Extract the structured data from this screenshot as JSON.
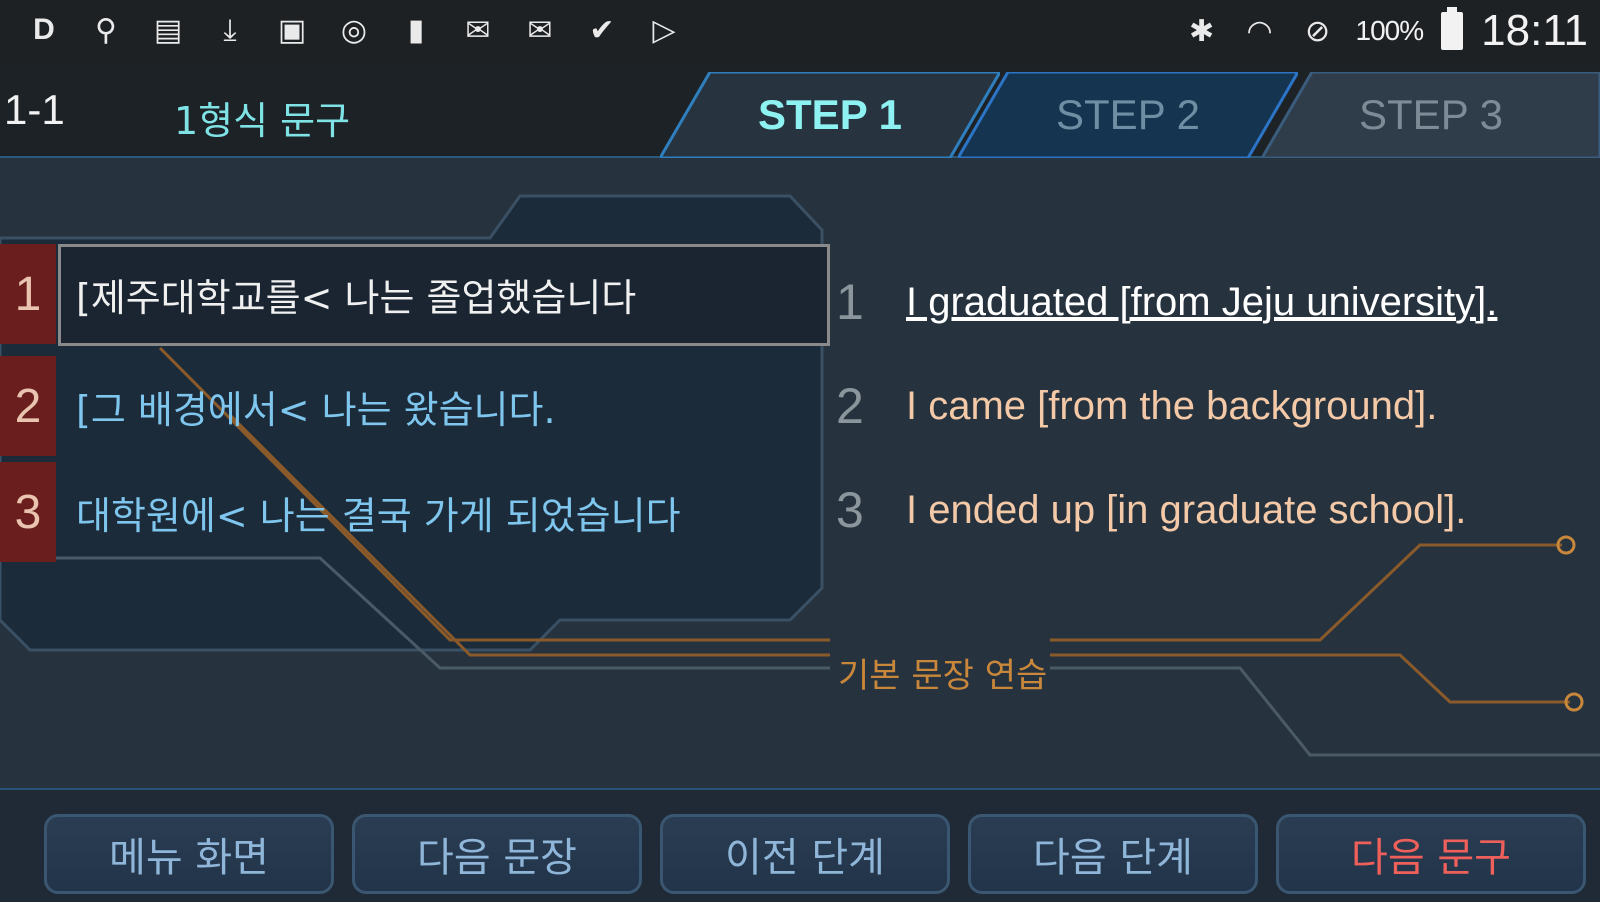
{
  "statusbar": {
    "left_icons": [
      "d-app-icon",
      "usb-icon",
      "sim-icon",
      "download-icon",
      "image-icon",
      "sync-icon",
      "battery-saver-icon",
      "mail-icon",
      "mail-icon",
      "check-icon",
      "play-icon"
    ],
    "battery_pct": "100%",
    "clock": "18:11"
  },
  "header": {
    "lesson_number": "1-1",
    "lesson_title": "1형식 문구",
    "tabs": [
      {
        "label": "STEP 1",
        "active": true
      },
      {
        "label": "STEP 2",
        "active": false
      },
      {
        "label": "STEP 3",
        "active": false
      }
    ]
  },
  "korean_sentences": [
    {
      "num": "1",
      "text": "[제주대학교를< 나는 졸업했습니다",
      "selected": true
    },
    {
      "num": "2",
      "text": "[그 배경에서< 나는 왔습니다.",
      "selected": false
    },
    {
      "num": "3",
      "text": "대학원에< 나는 결국 가게 되었습니다",
      "selected": false
    }
  ],
  "english_sentences": [
    {
      "num": "1",
      "text": "I graduated [from Jeju university]."
    },
    {
      "num": "2",
      "text": "I came [from the background]."
    },
    {
      "num": "3",
      "text": "I ended up [in graduate school]."
    }
  ],
  "practice_label": "기본 문장 연습",
  "buttons": {
    "menu": "메뉴 화면",
    "next_sentence": "다음 문장",
    "prev_step": "이전 단계",
    "next_step": "다음 단계",
    "next_phrase": "다음 문구"
  },
  "colors": {
    "accent_cyan": "#8ef2f2",
    "number_red": "#6b1e1e",
    "circuit_orange": "#c9873b",
    "next_phrase_red": "#f0605a"
  }
}
